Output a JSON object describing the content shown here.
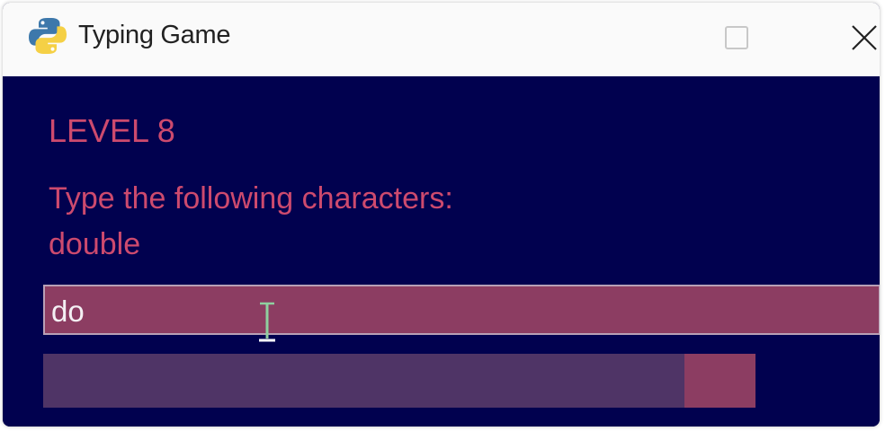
{
  "window": {
    "title": "Typing Game",
    "icon": "python-icon",
    "controls": {
      "minimize": "minimize-icon",
      "maximize": "maximize-icon",
      "close": "close-icon"
    }
  },
  "game": {
    "level_label": "LEVEL 8",
    "prompt_label": "Type the following characters:",
    "target_word": "double",
    "input_value": "do",
    "timer_progress": 0.9
  },
  "colors": {
    "background": "#01014f",
    "text": "#cd4a6e",
    "input_bg": "#8c3d62",
    "progress_fill": "#4f3466",
    "progress_track": "#8c3d62"
  }
}
